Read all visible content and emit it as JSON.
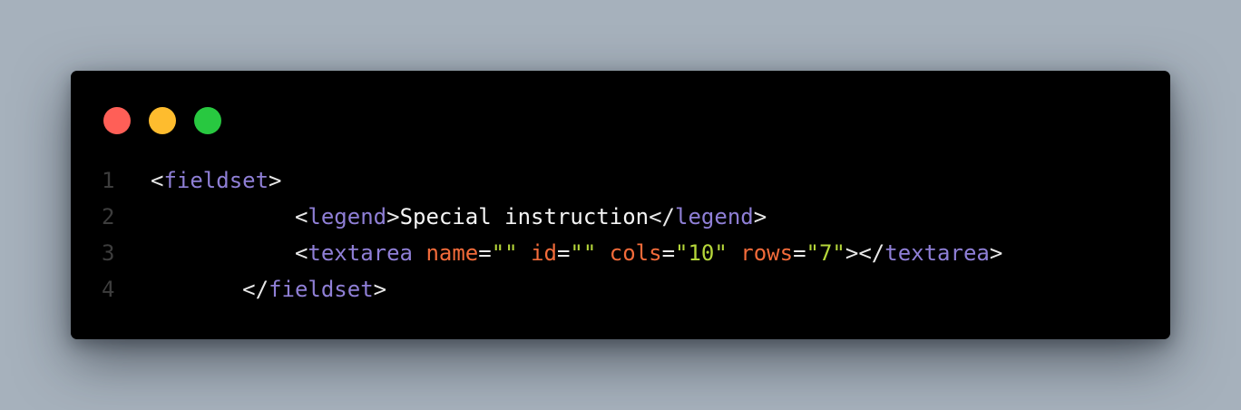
{
  "colors": {
    "background": "#a6b1bc",
    "window": "#000000",
    "close_dot": "#ff5f57",
    "minimize_dot": "#febc2e",
    "maximize_dot": "#28c840",
    "line_number": "#3d3d3d",
    "punctuation": "#e8e8e8",
    "tag": "#8f7fd6",
    "text": "#f5f5f5",
    "attribute": "#f26b3a",
    "string": "#b5d63a"
  },
  "lines": [
    {
      "number": "1",
      "indent": "",
      "tokens": [
        {
          "t": "punct",
          "v": "<"
        },
        {
          "t": "tag",
          "v": "fieldset"
        },
        {
          "t": "punct",
          "v": ">"
        }
      ]
    },
    {
      "number": "2",
      "indent": "           ",
      "tokens": [
        {
          "t": "punct",
          "v": "<"
        },
        {
          "t": "tag",
          "v": "legend"
        },
        {
          "t": "punct",
          "v": ">"
        },
        {
          "t": "text",
          "v": "Special instruction"
        },
        {
          "t": "punct",
          "v": "</"
        },
        {
          "t": "tag",
          "v": "legend"
        },
        {
          "t": "punct",
          "v": ">"
        }
      ]
    },
    {
      "number": "3",
      "indent": "           ",
      "tokens": [
        {
          "t": "punct",
          "v": "<"
        },
        {
          "t": "tag",
          "v": "textarea"
        },
        {
          "t": "punct",
          "v": " "
        },
        {
          "t": "attr",
          "v": "name"
        },
        {
          "t": "punct",
          "v": "="
        },
        {
          "t": "string",
          "v": "\"\""
        },
        {
          "t": "punct",
          "v": " "
        },
        {
          "t": "attr",
          "v": "id"
        },
        {
          "t": "punct",
          "v": "="
        },
        {
          "t": "string",
          "v": "\"\""
        },
        {
          "t": "punct",
          "v": " "
        },
        {
          "t": "attr",
          "v": "cols"
        },
        {
          "t": "punct",
          "v": "="
        },
        {
          "t": "string",
          "v": "\"10\""
        },
        {
          "t": "punct",
          "v": " "
        },
        {
          "t": "attr",
          "v": "rows"
        },
        {
          "t": "punct",
          "v": "="
        },
        {
          "t": "string",
          "v": "\"7\""
        },
        {
          "t": "punct",
          "v": "></"
        },
        {
          "t": "tag",
          "v": "textarea"
        },
        {
          "t": "punct",
          "v": ">"
        }
      ]
    },
    {
      "number": "4",
      "indent": "       ",
      "tokens": [
        {
          "t": "punct",
          "v": "</"
        },
        {
          "t": "tag",
          "v": "fieldset"
        },
        {
          "t": "punct",
          "v": ">"
        }
      ]
    }
  ]
}
